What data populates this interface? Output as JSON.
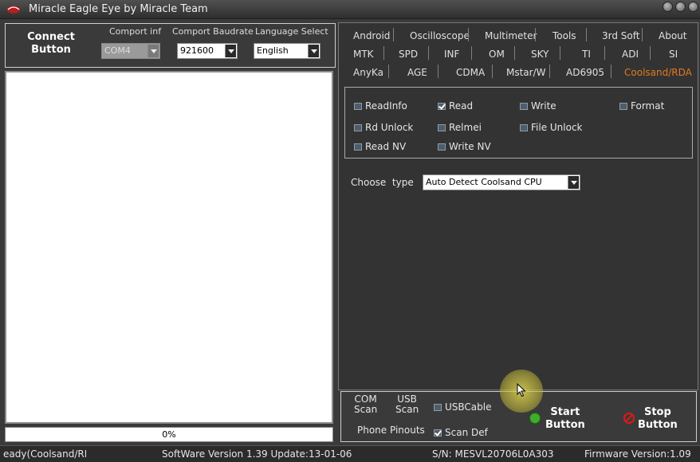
{
  "window": {
    "title": "Miracle Eagle Eye by Miracle Team"
  },
  "connection": {
    "connect_button": "Connect\nButton",
    "comport_label": "Comport inf",
    "comport_value": "COM4",
    "baud_label": "Comport Baudrate",
    "baud_value": "921600",
    "lang_label": "Language Select",
    "lang_value": "English"
  },
  "progress": {
    "text": "0%"
  },
  "tabs": {
    "row1": [
      "Android",
      "Oscilloscope",
      "Multimeter",
      "Tools",
      "3rd Soft",
      "About"
    ],
    "row2": [
      "MTK",
      "SPD",
      "INF",
      "OM",
      "SKY",
      "TI",
      "ADI",
      "SI"
    ],
    "row3": [
      "AnyKa",
      "AGE",
      "CDMA",
      "Mstar/W",
      "AD6905",
      "Coolsand/RDA"
    ],
    "active": "Coolsand/RDA"
  },
  "options": {
    "readinfo": "ReadInfo",
    "read": "Read",
    "write": "Write",
    "format": "Format",
    "rd_unlock": "Rd Unlock",
    "relmei": "Relmei",
    "file_unlock": "File Unlock",
    "read_nv": "Read NV",
    "write_nv": "Write NV"
  },
  "choose_type": {
    "label": "Choose  type",
    "value": "Auto Detect Coolsand CPU"
  },
  "bottom": {
    "com_scan": "COM\nScan",
    "usb_scan": "USB\nScan",
    "usb_cable": "USBCable",
    "phone_pinouts": "Phone Pinouts",
    "scan_def": "Scan Def",
    "start_button": "Start\nButton",
    "stop_button": "Stop\nButton"
  },
  "status": {
    "state": "eady(Coolsand/RDA",
    "software": "SoftWare Version 1.39  Update:13-01-06",
    "serial": "S/N: MESVL20706L0A303",
    "firmware": "Firmware Version:1.09"
  },
  "colors": {
    "active_tab": "#e07a20",
    "start_icon": "#3fae2a",
    "stop_icon": "#e01818"
  }
}
